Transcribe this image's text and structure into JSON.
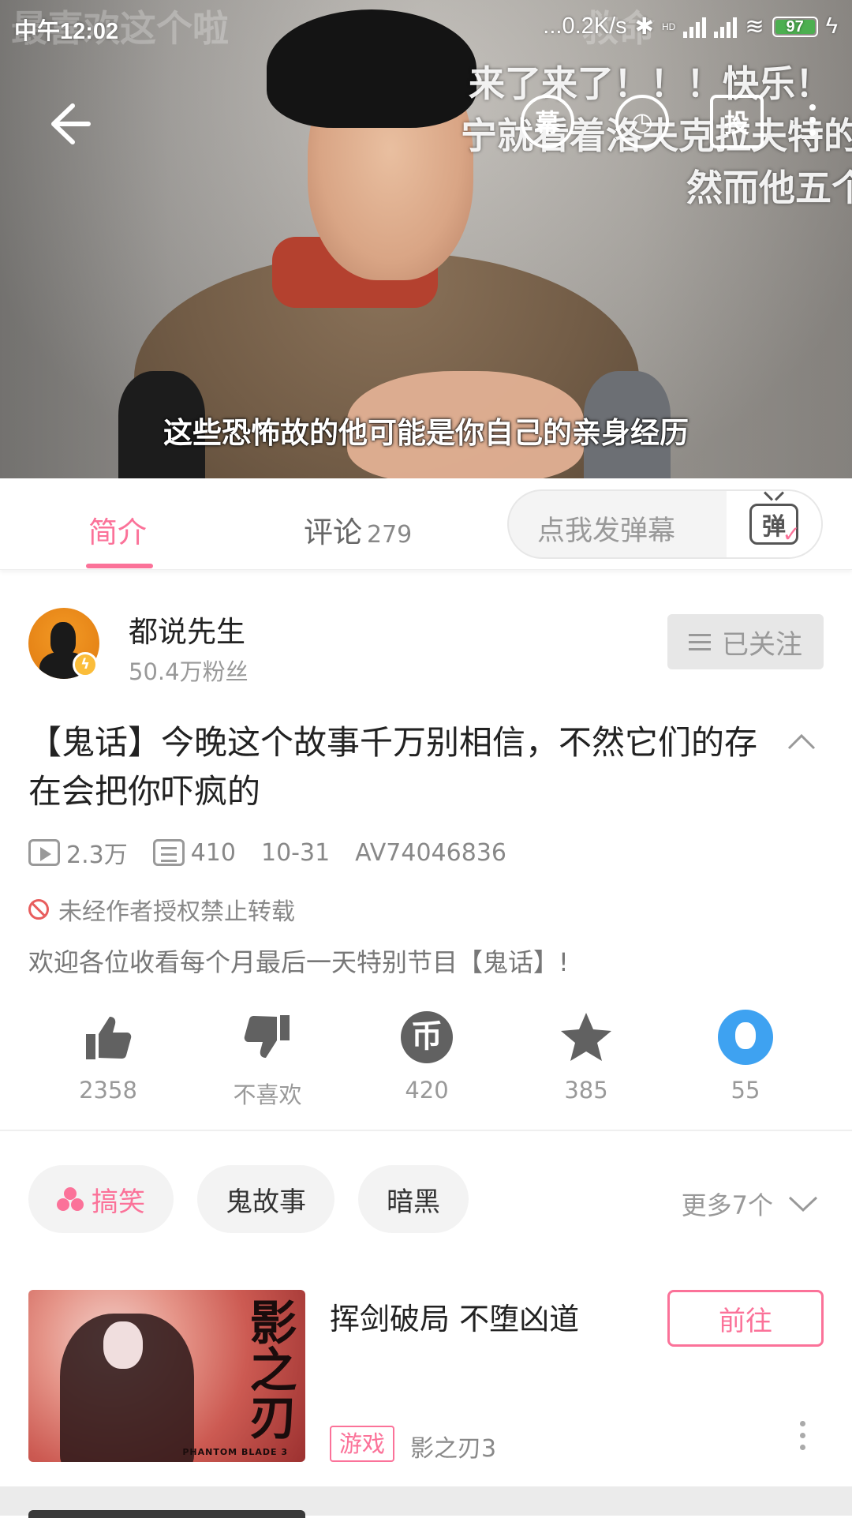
{
  "status_bar": {
    "time": "中午12:02",
    "network_speed": "...0.2K/s",
    "hd": "HD",
    "battery": "97"
  },
  "video": {
    "danmaku": [
      "最喜欢这个啦",
      "救命",
      "来了来了！！！快乐！",
      "宁就看着洛夫克拉夫特的",
      "然而他五个"
    ],
    "subtitle": "这些恐怖故的他可能是你自己的亲身经历",
    "icons": {
      "danmaku_toggle": "幕",
      "cast": "投"
    }
  },
  "tabs": {
    "intro_label": "简介",
    "comments_label": "评论",
    "comments_count": "279",
    "danmaku_placeholder": "点我发弹幕",
    "danmaku_button_char": "弹"
  },
  "uploader": {
    "name": "都说先生",
    "fans": "50.4万粉丝",
    "follow_label": "已关注"
  },
  "video_info": {
    "title": "【鬼话】今晚这个故事千万别相信，不然它们的存在会把你吓疯的",
    "views": "2.3万",
    "danmaku_count": "410",
    "date": "10-31",
    "av_id": "AV74046836",
    "notice": "未经作者授权禁止转载",
    "description": "欢迎各位收看每个月最后一天特别节目【鬼话】!"
  },
  "actions": {
    "like": "2358",
    "dislike": "不喜欢",
    "coin": "420",
    "coin_symbol": "币",
    "favorite": "385",
    "share": "55"
  },
  "tags": {
    "items": [
      "搞笑",
      "鬼故事",
      "暗黑"
    ],
    "more": "更多7个"
  },
  "ad": {
    "title": "挥剑破局 不堕凶道",
    "go_label": "前往",
    "category": "游戏",
    "game_name": "影之刃3",
    "image_calligraphy": "影之刃",
    "image_caption": "PHANTOM BLADE 3"
  },
  "colors": {
    "accent": "#fb7299",
    "share_blue": "#3ea2f1",
    "coin_gray": "#616161"
  }
}
